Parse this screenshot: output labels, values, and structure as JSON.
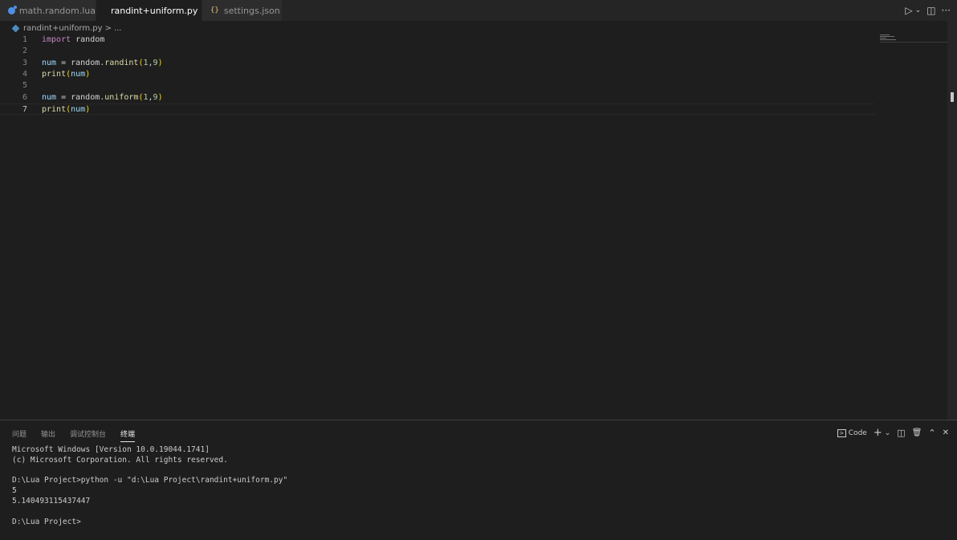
{
  "tabs": [
    {
      "label": "math.random.lua",
      "icon": "lua-file-icon"
    },
    {
      "label": "randint+uniform.py",
      "icon": "python-file-icon",
      "active": true,
      "close": "✕"
    },
    {
      "label": "settings.json",
      "icon": "json-file-icon",
      "icon_glyph": "{}"
    }
  ],
  "tab_actions": {
    "run": "▷",
    "run_menu": "⌄",
    "split": "◫",
    "more": "···"
  },
  "breadcrumb": {
    "file": "randint+uniform.py",
    "sep": ">",
    "rest": "..."
  },
  "editor": {
    "line_numbers": [
      "1",
      "2",
      "3",
      "4",
      "5",
      "6",
      "7"
    ],
    "lines": [
      [
        {
          "t": "kw",
          "v": "import"
        },
        {
          "t": "plain",
          "v": " random"
        }
      ],
      [],
      [
        {
          "t": "var",
          "v": "num"
        },
        {
          "t": "plain",
          "v": " = random."
        },
        {
          "t": "fn",
          "v": "randint"
        },
        {
          "t": "par",
          "v": "("
        },
        {
          "t": "num",
          "v": "1"
        },
        {
          "t": "plain",
          "v": ","
        },
        {
          "t": "num",
          "v": "9"
        },
        {
          "t": "par",
          "v": ")"
        }
      ],
      [
        {
          "t": "fn",
          "v": "print"
        },
        {
          "t": "par",
          "v": "("
        },
        {
          "t": "var",
          "v": "num"
        },
        {
          "t": "par",
          "v": ")"
        }
      ],
      [],
      [
        {
          "t": "var",
          "v": "num"
        },
        {
          "t": "plain",
          "v": " = random."
        },
        {
          "t": "fn",
          "v": "uniform"
        },
        {
          "t": "par",
          "v": "("
        },
        {
          "t": "num",
          "v": "1"
        },
        {
          "t": "plain",
          "v": ","
        },
        {
          "t": "num",
          "v": "9"
        },
        {
          "t": "par",
          "v": ")"
        }
      ],
      [
        {
          "t": "fn",
          "v": "print"
        },
        {
          "t": "par",
          "v": "("
        },
        {
          "t": "var",
          "v": "num"
        },
        {
          "t": "par",
          "v": ")"
        }
      ]
    ],
    "current_line": 7
  },
  "panel": {
    "tabs": [
      "问题",
      "输出",
      "调试控制台",
      "终端"
    ],
    "active_tab": "终端",
    "terminal_label": "Code",
    "actions": {
      "add": "+",
      "add_menu": "⌄",
      "split": "◫",
      "trash": "🗑",
      "maximize": "⌃",
      "close": "✕"
    },
    "terminal_lines": [
      "Microsoft Windows [Version 10.0.19044.1741]",
      "(c) Microsoft Corporation. All rights reserved.",
      "",
      "D:\\Lua Project>python -u \"d:\\Lua Project\\randint+uniform.py\"",
      "5",
      "5.140493115437447",
      "",
      "D:\\Lua Project>"
    ]
  },
  "colors": {
    "editor_bg": "#1e1e1e",
    "tabbar_bg": "#252526",
    "keyword": "#c586c0",
    "function": "#dcdcaa",
    "variable": "#9cdcfe",
    "number": "#b5cea8",
    "bracket": "#ffd700"
  }
}
